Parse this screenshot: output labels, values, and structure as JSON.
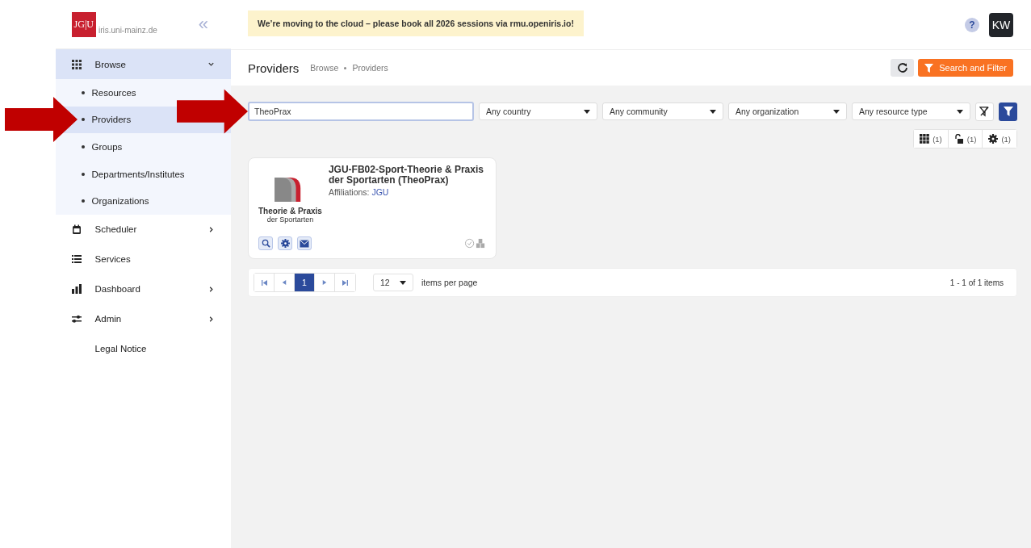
{
  "sidebar": {
    "logo": "JG|U",
    "site": "iris.uni-mainz.de",
    "collapse": "«",
    "items": [
      {
        "label": "Browse",
        "kind": "grid",
        "expanded": true,
        "has_children": true,
        "children": [
          {
            "label": "Resources",
            "selected": false
          },
          {
            "label": "Providers",
            "selected": true
          },
          {
            "label": "Groups",
            "selected": false
          },
          {
            "label": "Departments/Institutes",
            "selected": false
          },
          {
            "label": "Organizations",
            "selected": false
          }
        ]
      },
      {
        "label": "Scheduler",
        "kind": "calendar",
        "expanded": false,
        "has_children": true
      },
      {
        "label": "Services",
        "kind": "list",
        "expanded": false,
        "has_children": false
      },
      {
        "label": "Dashboard",
        "kind": "bars",
        "expanded": false,
        "has_children": true
      },
      {
        "label": "Admin",
        "kind": "sliders",
        "expanded": false,
        "has_children": true
      },
      {
        "label": "Legal Notice",
        "kind": "plain",
        "expanded": false,
        "has_children": false
      }
    ]
  },
  "notice": "We’re moving to the cloud – please book all 2026 sessions via rmu.openiris.io!",
  "help": "?",
  "avatar": "KW",
  "header": {
    "title": "Providers",
    "breadcrumb": [
      "Browse",
      "Providers"
    ],
    "search_button": "Search and Filter"
  },
  "filters": {
    "search_value": "TheoPrax",
    "dropdowns": [
      "Any country",
      "Any community",
      "Any organization",
      "Any resource type"
    ]
  },
  "counts": [
    {
      "kind": "grid",
      "label": "(1)"
    },
    {
      "kind": "lock",
      "label": "(1)"
    },
    {
      "kind": "gear",
      "label": "(1)"
    }
  ],
  "cards": [
    {
      "title": "JGU-FB02-Sport-Theorie & Praxis der Sportarten (TheoPrax)",
      "affiliations_label": "Affiliations:",
      "affiliation": "JGU",
      "logo_line1": "Theorie & Praxis",
      "logo_line2": "der Sportarten"
    }
  ],
  "pager": {
    "pages": [
      {
        "label": "1",
        "selected": true
      }
    ],
    "per_page": "12",
    "per_page_label": "items per page",
    "summary": "1 - 1 of 1 items"
  },
  "annotations": [
    {
      "kind": "arrow"
    },
    {
      "kind": "arrow"
    }
  ]
}
